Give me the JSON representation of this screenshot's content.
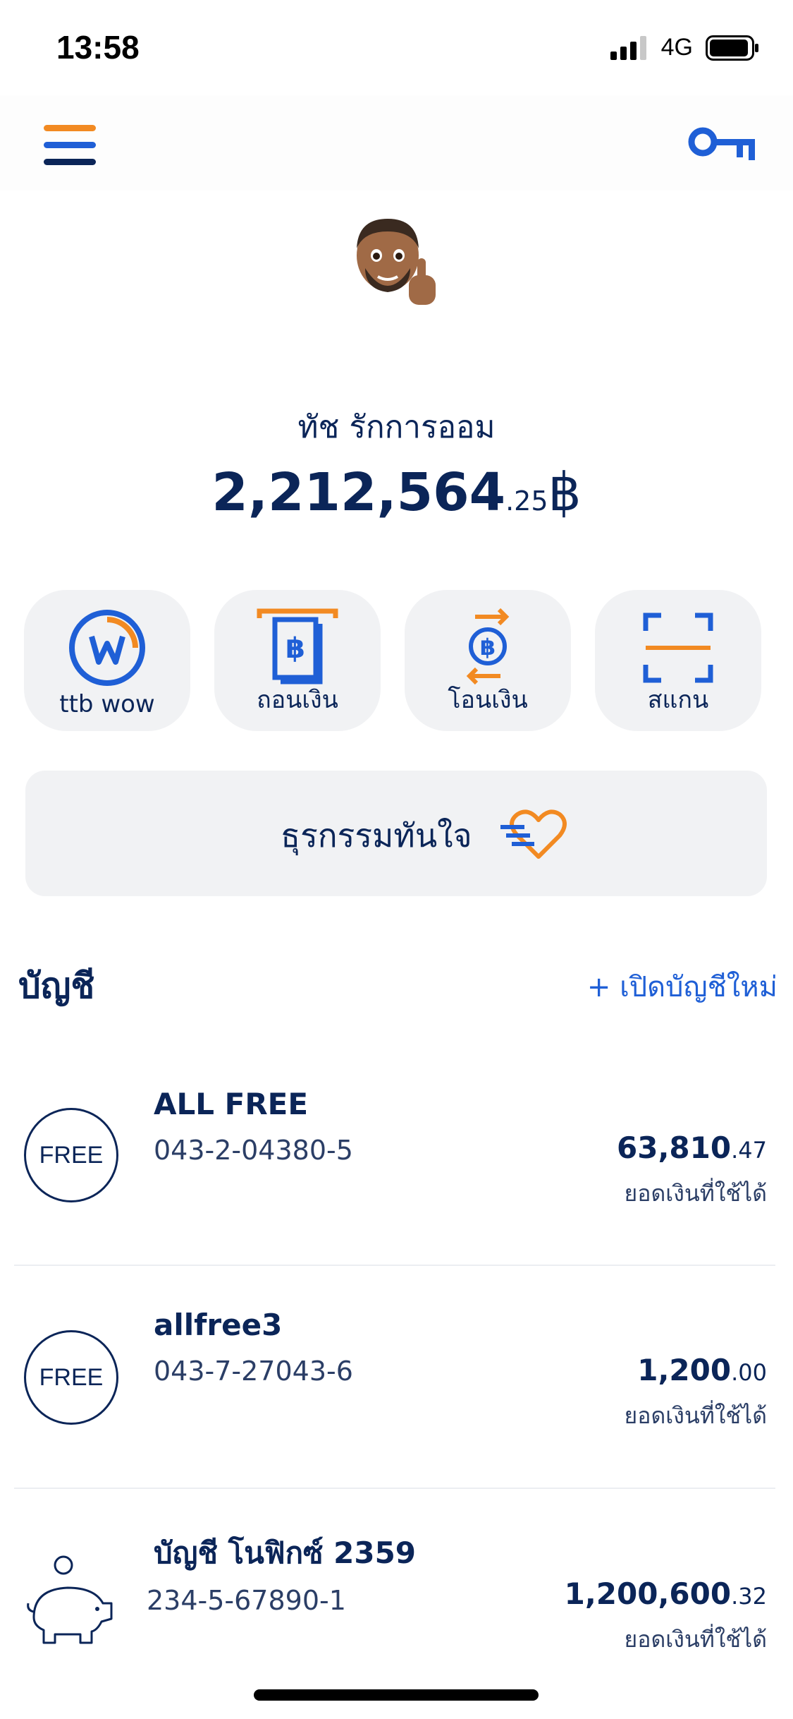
{
  "status_bar": {
    "time": "13:58",
    "network": "4G"
  },
  "colors": {
    "primary_navy": "#0b2558",
    "accent_blue": "#1f5fd6",
    "accent_orange": "#f28a22",
    "tile_bg": "#f1f2f4"
  },
  "header": {
    "menu_icon": "hamburger-menu-icon",
    "key_icon": "key-icon"
  },
  "profile": {
    "name": "ทัช รักการออม",
    "balance_int": "2,212,564",
    "balance_dec": ".25",
    "currency": "฿"
  },
  "quick_actions": [
    {
      "label": "ttb wow",
      "icon": "ttb-wow-icon"
    },
    {
      "label": "ถอนเงิน",
      "icon": "withdraw-icon"
    },
    {
      "label": "โอนเงิน",
      "icon": "transfer-icon"
    },
    {
      "label": "สแกน",
      "icon": "scan-icon"
    }
  ],
  "quick_banner": {
    "label": "ธุรกรรมทันใจ",
    "icon": "fast-heart-icon"
  },
  "accounts_section": {
    "title": "บัญชี",
    "action": "+ เปิดบัญชีใหม่"
  },
  "accounts": [
    {
      "badge": "FREE",
      "name": "ALL FREE",
      "number": "043-2-04380-5",
      "amount_int": "63,810",
      "amount_dec": ".47",
      "amount_label": "ยอดเงินที่ใช้ได้"
    },
    {
      "badge": "FREE",
      "name": "allfree3",
      "number": "043-7-27043-6",
      "amount_int": "1,200",
      "amount_dec": ".00",
      "amount_label": "ยอดเงินที่ใช้ได้"
    },
    {
      "badge": "",
      "icon": "piggy-bank-icon",
      "name": "บัญชี โนฟิกซ์ 2359",
      "number": "234-5-67890-1",
      "amount_int": "1,200,600",
      "amount_dec": ".32",
      "amount_label": "ยอดเงินที่ใช้ได้"
    }
  ]
}
